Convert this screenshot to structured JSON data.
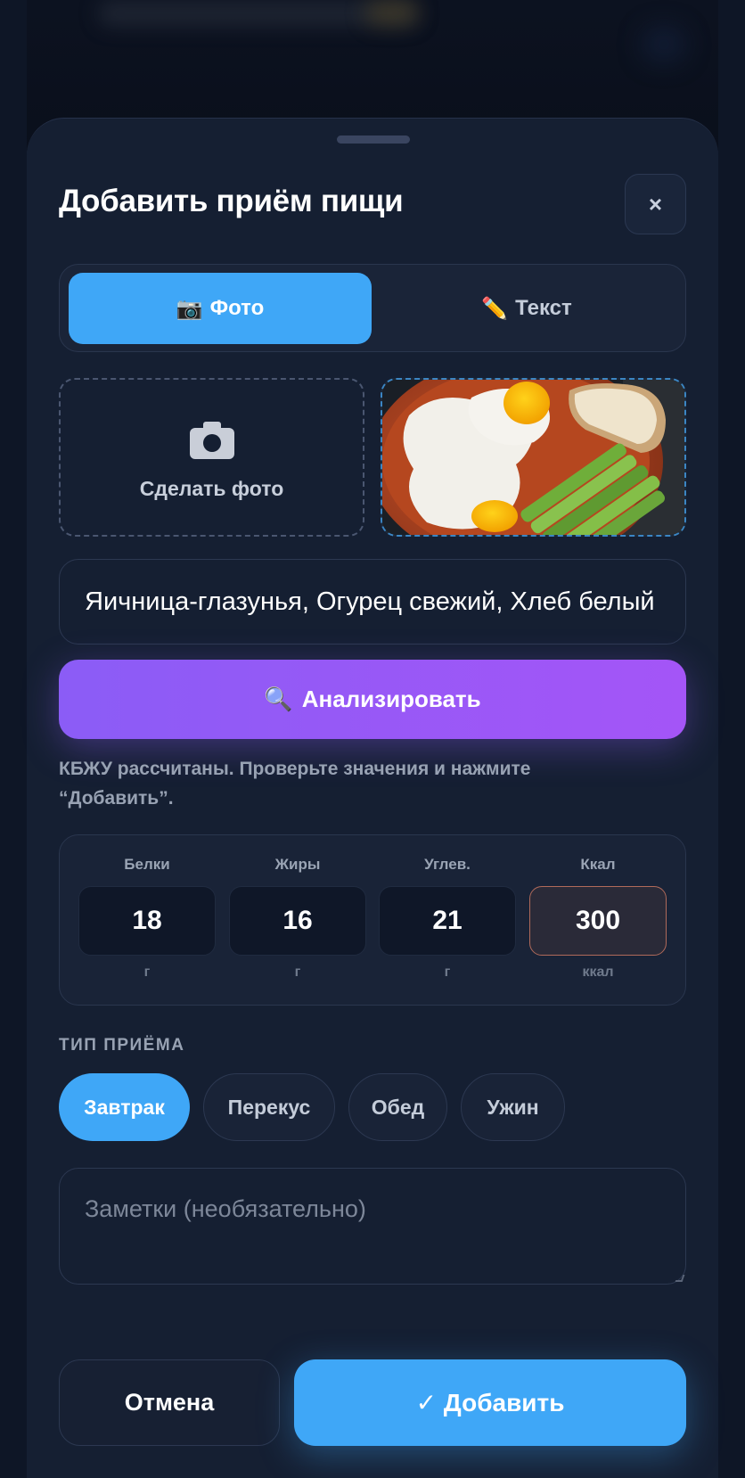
{
  "modal": {
    "title": "Добавить приём пищи",
    "close_label": "×"
  },
  "mode_tabs": [
    {
      "icon": "📷",
      "label": "Фото",
      "active": true
    },
    {
      "icon": "✏️",
      "label": "Текст",
      "active": false
    }
  ],
  "photo": {
    "take_photo_label": "Сделать фото",
    "preview_icon": "food-photo-thumbnail"
  },
  "food_input": {
    "value": "Яичница-глазунья, Огурец свежий, Хлеб белый"
  },
  "analyze_button": {
    "icon": "🔍",
    "label": "Анализировать"
  },
  "hint_text": "КБЖУ рассчитаны. Проверьте значения и нажмите “Добавить”.",
  "macros": [
    {
      "label": "Белки",
      "value": "18",
      "unit": "г"
    },
    {
      "label": "Жиры",
      "value": "16",
      "unit": "г"
    },
    {
      "label": "Углев.",
      "value": "21",
      "unit": "г"
    },
    {
      "label": "Ккал",
      "value": "300",
      "unit": "ккал"
    }
  ],
  "meal_type": {
    "section_label": "ТИП ПРИЁМА",
    "options": [
      {
        "label": "Завтрак",
        "active": true
      },
      {
        "label": "Перекус",
        "active": false
      },
      {
        "label": "Обед",
        "active": false
      },
      {
        "label": "Ужин",
        "active": false
      }
    ]
  },
  "notes": {
    "placeholder": "Заметки (необязательно)",
    "value": ""
  },
  "footer": {
    "cancel_label": "Отмена",
    "add_label": "✓ Добавить"
  },
  "colors": {
    "accent_blue": "#3fa7f7",
    "accent_purple": "#8b5cf6",
    "background": "#0e1626",
    "sheet": "#151f32"
  }
}
